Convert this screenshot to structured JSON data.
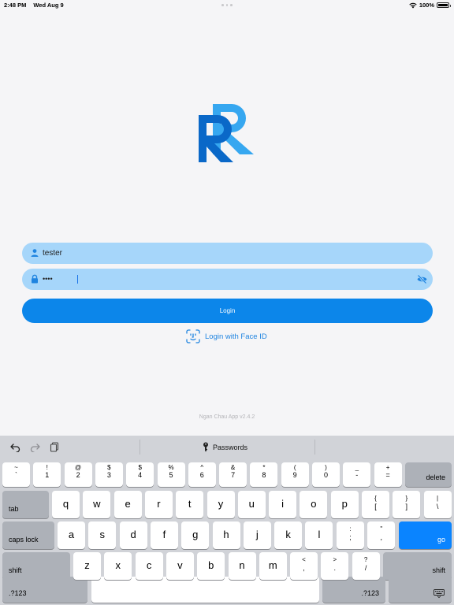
{
  "status_bar": {
    "time": "2:48 PM",
    "date": "Wed Aug 9",
    "battery": "100%",
    "battery_level": 1.0
  },
  "login_form": {
    "username_value": "tester",
    "password_value": "••••",
    "login_label": "Login",
    "faceid_label": "Login with Face ID",
    "version": "Ngan Chau App v2.4.2"
  },
  "colors": {
    "accent": "#0c86ea",
    "field_bg": "#a6d6fa",
    "logo_dark": "#0a68c8",
    "logo_light": "#36a7f0",
    "link": "#1f84e0"
  },
  "icons": {
    "username": "user-icon",
    "password": "lock-icon",
    "toggle": "eye-slash-icon",
    "faceid": "faceid-icon",
    "undo": "undo-icon",
    "redo": "redo-icon",
    "paste": "clipboard-icon",
    "passwords": "key-icon",
    "dismiss": "keyboard-dismiss-icon"
  },
  "keyboard": {
    "toolbar": {
      "passwords_label": "Passwords"
    },
    "number_row": [
      {
        "top": "~",
        "bottom": "`"
      },
      {
        "top": "!",
        "bottom": "1"
      },
      {
        "top": "@",
        "bottom": "2"
      },
      {
        "top": "$",
        "bottom": "3"
      },
      {
        "top": "$",
        "bottom": "4"
      },
      {
        "top": "%",
        "bottom": "5"
      },
      {
        "top": "^",
        "bottom": "6"
      },
      {
        "top": "&",
        "bottom": "7"
      },
      {
        "top": "*",
        "bottom": "8"
      },
      {
        "top": "(",
        "bottom": "9"
      },
      {
        "top": ")",
        "bottom": "0"
      },
      {
        "top": "_",
        "bottom": "-"
      },
      {
        "top": "+",
        "bottom": "="
      }
    ],
    "delete_label": "delete",
    "tab_label": "tab",
    "row_q": [
      "q",
      "w",
      "e",
      "r",
      "t",
      "y",
      "u",
      "i",
      "o",
      "p"
    ],
    "row_q_symbols": [
      {
        "top": "{",
        "bottom": "["
      },
      {
        "top": "}",
        "bottom": "]"
      },
      {
        "top": "|",
        "bottom": "\\"
      }
    ],
    "caps_label": "caps lock",
    "row_a": [
      "a",
      "s",
      "d",
      "f",
      "g",
      "h",
      "j",
      "k",
      "l"
    ],
    "row_a_symbols": [
      {
        "top": ":",
        "bottom": ";"
      },
      {
        "top": "\"",
        "bottom": ","
      }
    ],
    "go_label": "go",
    "shift_label": "shift",
    "row_z": [
      "z",
      "x",
      "c",
      "v",
      "b",
      "n",
      "m"
    ],
    "row_z_symbols": [
      {
        "top": "<",
        "bottom": ","
      },
      {
        "top": ">",
        "bottom": "."
      },
      {
        "top": "?",
        "bottom": "/"
      }
    ],
    "numbers_label": ".?123"
  }
}
